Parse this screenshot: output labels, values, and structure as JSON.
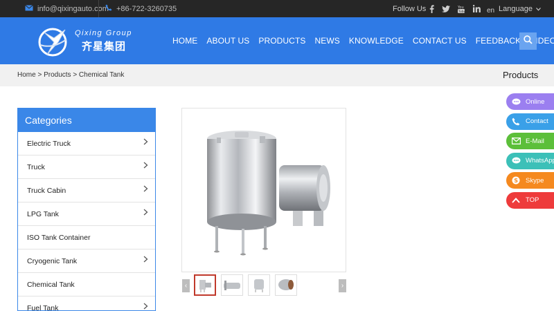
{
  "topbar": {
    "email": "info@qixingauto.com",
    "phone": "+86-722-3260735",
    "follow_label": "Follow Us",
    "social_icons": [
      "facebook-icon",
      "twitter-icon",
      "youtube-icon",
      "linkedin-icon"
    ],
    "lang_code": "en",
    "language_label": "Language"
  },
  "header": {
    "logo_en": "Qixing Group",
    "logo_cn": "齐星集团",
    "nav": [
      "HOME",
      "ABOUT US",
      "PRODUCTS",
      "NEWS",
      "KNOWLEDGE",
      "CONTACT US",
      "FEEDBACK",
      "VIDEO"
    ]
  },
  "breadcrumb": {
    "path": "Home > Products > Chemical Tank",
    "section_title": "Products"
  },
  "categories": {
    "title": "Categories",
    "items": [
      {
        "label": "Electric Truck",
        "arrow": true
      },
      {
        "label": "Truck",
        "arrow": true
      },
      {
        "label": "Truck Cabin",
        "arrow": true
      },
      {
        "label": "LPG Tank",
        "arrow": true
      },
      {
        "label": "ISO Tank Container",
        "arrow": false
      },
      {
        "label": "Cryogenic Tank",
        "arrow": true
      },
      {
        "label": "Chemical Tank",
        "arrow": false
      },
      {
        "label": "Fuel Tank",
        "arrow": true
      }
    ]
  },
  "floating": [
    {
      "label": "Online",
      "color": "#9b7ff0",
      "icon": "chat-icon"
    },
    {
      "label": "Contact",
      "color": "#3aa0e8",
      "icon": "phone-icon"
    },
    {
      "label": "E-Mail",
      "color": "#5cbf3a",
      "icon": "mail-icon"
    },
    {
      "label": "WhatsApp",
      "color": "#3cc0b8",
      "icon": "whatsapp-icon"
    },
    {
      "label": "Skype",
      "color": "#f5891f",
      "icon": "skype-icon"
    },
    {
      "label": "TOP",
      "color": "#ee3b3b",
      "icon": "arrow-up-icon"
    }
  ],
  "colors": {
    "brand_blue": "#2f7ae5",
    "topbar": "#262626"
  }
}
